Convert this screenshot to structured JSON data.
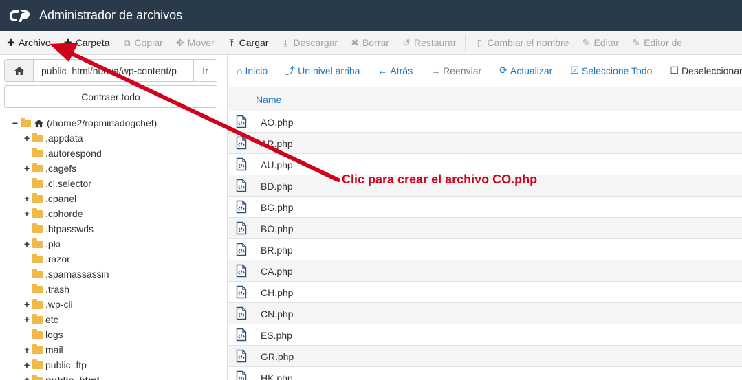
{
  "window": {
    "title": "Administrador de archivos"
  },
  "toolbar": {
    "items": [
      {
        "label": "Archivo",
        "icon": "plus-icon",
        "glyph": "✚",
        "enabled": true
      },
      {
        "label": "Carpeta",
        "icon": "plus-icon",
        "glyph": "✚",
        "enabled": true
      },
      {
        "label": "Copiar",
        "icon": "copy-icon",
        "glyph": "⧉",
        "enabled": false
      },
      {
        "label": "Mover",
        "icon": "move-icon",
        "glyph": "✥",
        "enabled": false
      },
      {
        "label": "Cargar",
        "icon": "upload-icon",
        "glyph": "⤒",
        "enabled": true
      },
      {
        "label": "Descargar",
        "icon": "download-icon",
        "glyph": "⤓",
        "enabled": false
      },
      {
        "label": "Borrar",
        "icon": "delete-icon",
        "glyph": "✖",
        "enabled": false
      },
      {
        "label": "Restaurar",
        "icon": "restore-icon",
        "glyph": "↺",
        "enabled": false
      },
      {
        "label": "Cambiar el nombre",
        "icon": "rename-icon",
        "glyph": "▯",
        "enabled": false
      },
      {
        "label": "Editar",
        "icon": "edit-icon",
        "glyph": "✎",
        "enabled": false
      },
      {
        "label": "Editor de",
        "icon": "editor-icon",
        "glyph": "✎",
        "enabled": false
      }
    ]
  },
  "path": {
    "value": "public_html/nueva/wp-content/p",
    "go_label": "Ir"
  },
  "collapse_label": "Contraer todo",
  "tree": [
    {
      "label": "(/home2/ropminadogchef)",
      "toggle": "−",
      "level": 0,
      "home": true
    },
    {
      "label": ".appdata",
      "toggle": "+",
      "level": 1
    },
    {
      "label": ".autorespond",
      "toggle": "",
      "level": 1
    },
    {
      "label": ".cagefs",
      "toggle": "+",
      "level": 1
    },
    {
      "label": ".cl.selector",
      "toggle": "",
      "level": 1
    },
    {
      "label": ".cpanel",
      "toggle": "+",
      "level": 1
    },
    {
      "label": ".cphorde",
      "toggle": "+",
      "level": 1
    },
    {
      "label": ".htpasswds",
      "toggle": "",
      "level": 1
    },
    {
      "label": ".pki",
      "toggle": "+",
      "level": 1
    },
    {
      "label": ".razor",
      "toggle": "",
      "level": 1
    },
    {
      "label": ".spamassassin",
      "toggle": "",
      "level": 1
    },
    {
      "label": ".trash",
      "toggle": "",
      "level": 1
    },
    {
      "label": ".wp-cli",
      "toggle": "+",
      "level": 1
    },
    {
      "label": "etc",
      "toggle": "+",
      "level": 1
    },
    {
      "label": "logs",
      "toggle": "",
      "level": 1
    },
    {
      "label": "mail",
      "toggle": "+",
      "level": 1
    },
    {
      "label": "public_ftp",
      "toggle": "+",
      "level": 1
    },
    {
      "label": "public_html",
      "toggle": "+",
      "level": 1,
      "bold": true
    }
  ],
  "nav": {
    "items": [
      {
        "label": "Inicio",
        "icon": "home-icon",
        "glyph": "⌂",
        "style": ""
      },
      {
        "label": "Un nivel arriba",
        "icon": "level-up-icon",
        "glyph": "⤴",
        "style": ""
      },
      {
        "label": "Atrás",
        "icon": "back-icon",
        "glyph": "←",
        "style": ""
      },
      {
        "label": "Reenviar",
        "icon": "forward-icon",
        "glyph": "→",
        "style": "dis"
      },
      {
        "label": "Actualizar",
        "icon": "refresh-icon",
        "glyph": "⟳",
        "style": ""
      },
      {
        "label": "Seleccione Todo",
        "icon": "checkbox-checked-icon",
        "glyph": "☑",
        "style": ""
      },
      {
        "label": "Deseleccionar",
        "icon": "checkbox-empty-icon",
        "glyph": "☐",
        "style": "dark"
      }
    ]
  },
  "table": {
    "header_name": "Name",
    "files": [
      "AO.php",
      "AR.php",
      "AU.php",
      "BD.php",
      "BG.php",
      "BO.php",
      "BR.php",
      "CA.php",
      "CH.php",
      "CN.php",
      "ES.php",
      "GR.php",
      "HK.php"
    ]
  },
  "annotation": {
    "text": "Clic para crear el archivo CO.php",
    "color": "#d0021b"
  },
  "colors": {
    "titlebar": "#293a4a",
    "link": "#1f78c1",
    "folder": "#f0b94a"
  }
}
